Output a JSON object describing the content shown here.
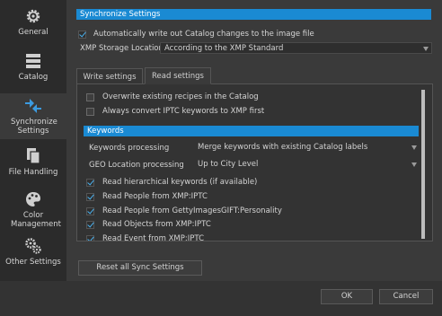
{
  "sidebar": {
    "items": [
      {
        "label": "General",
        "icon": "gear-icon"
      },
      {
        "label": "Catalog",
        "icon": "catalog-icon"
      },
      {
        "label": "Synchronize Settings",
        "icon": "sync-icon"
      },
      {
        "label": "File Handling",
        "icon": "files-icon"
      },
      {
        "label": "Color Management",
        "icon": "palette-icon"
      },
      {
        "label": "Other Settings",
        "icon": "gears-icon"
      }
    ]
  },
  "main": {
    "section_title": "Synchronize Settings",
    "auto_write_label": "Automatically write out Catalog changes to the image file",
    "auto_write_checked": true,
    "xmp_storage_label": "XMP Storage Location",
    "xmp_storage_value": "According to the XMP Standard",
    "tabs": [
      {
        "label": "Write settings",
        "active": false
      },
      {
        "label": "Read settings",
        "active": true
      }
    ],
    "read": {
      "overwrite_label": "Overwrite existing recipes in the Catalog",
      "overwrite_checked": false,
      "iptc_label": "Always convert IPTC keywords to XMP first",
      "iptc_checked": false,
      "keywords_title": "Keywords",
      "kw_processing_label": "Keywords processing",
      "kw_processing_value": "Merge keywords with existing Catalog labels",
      "geo_label": "GEO Location processing",
      "geo_value": "Up to City Level",
      "checks": [
        {
          "label": "Read hierarchical keywords (if available)",
          "checked": true
        },
        {
          "label": "Read People from XMP:IPTC",
          "checked": true
        },
        {
          "label": "Read People from GettyImagesGIFT:Personality",
          "checked": true
        },
        {
          "label": "Read Objects from XMP:IPTC",
          "checked": true
        },
        {
          "label": "Read Event from XMP:IPTC",
          "checked": true
        }
      ]
    },
    "reset_button": "Reset all Sync Settings"
  },
  "footer": {
    "ok_label": "OK",
    "cancel_label": "Cancel"
  },
  "colors": {
    "accent": "#1a8ad3",
    "check": "#4ab2f0"
  }
}
